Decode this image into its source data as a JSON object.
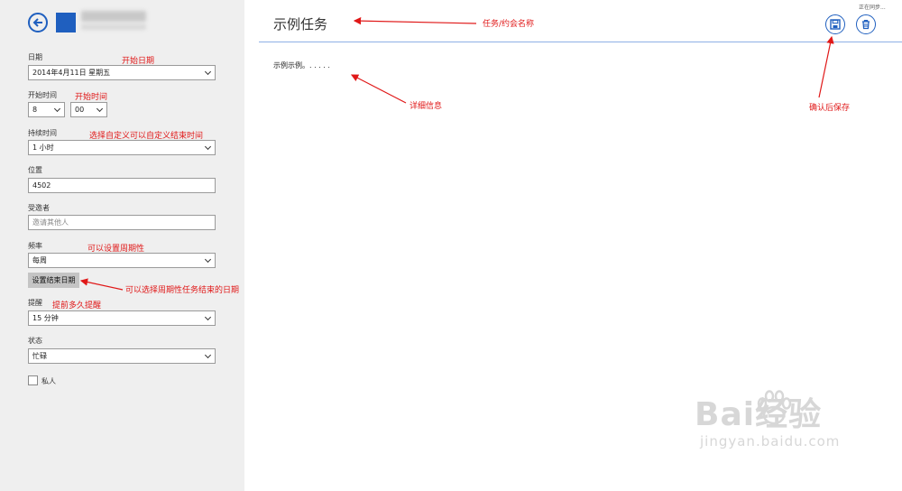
{
  "left": {
    "date_label": "日期",
    "date_value": "2014年4月11日 星期五",
    "start_time_label": "开始时间",
    "start_hour": "8",
    "start_minute": "00",
    "duration_label": "持续时间",
    "duration_value": "1 小时",
    "location_label": "位置",
    "location_value": "4502",
    "invitees_label": "受邀者",
    "invitees_placeholder": "邀请其他人",
    "frequency_label": "频率",
    "frequency_value": "每周",
    "set_end_date_button": "设置结束日期",
    "reminder_label": "提醒",
    "reminder_value": "15 分钟",
    "status_label": "状态",
    "status_value": "忙碌",
    "private_label": "私人"
  },
  "main": {
    "title": "示例任务",
    "description": "示例示例。. . . . .",
    "sync_status": "正在同步..."
  },
  "annotations": {
    "start_date": "开始日期",
    "start_time": "开始时间",
    "custom_duration": "选择自定义可以自定义结束时间",
    "periodic": "可以设置周期性",
    "end_date": "可以选择周期性任务结束的日期",
    "remind": "提前多久提醒",
    "task_name": "任务/约会名称",
    "details": "详细信息",
    "save": "确认后保存"
  },
  "watermark": {
    "brand": "Bai经验",
    "url": "jingyan.baidu.com"
  },
  "colors": {
    "accent": "#1f5fbf",
    "annotation": "#e01818",
    "sidebar_bg": "#efefef"
  },
  "icons": [
    "back-arrow-icon",
    "save-icon",
    "delete-icon",
    "chevron-down-icon",
    "checkbox-icon",
    "paw-icon"
  ]
}
